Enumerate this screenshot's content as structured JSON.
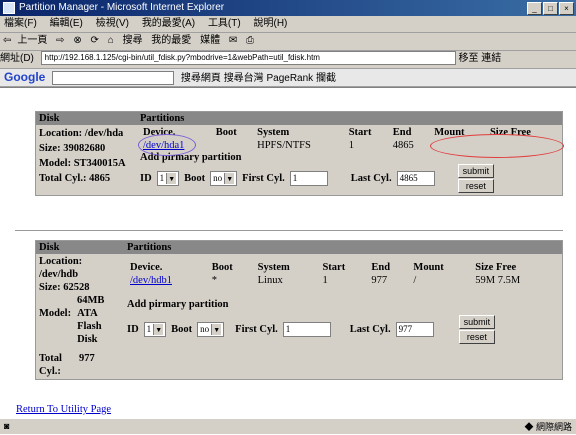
{
  "window": {
    "title": "Partition Manager - Microsoft Internet Explorer"
  },
  "menu": [
    "檔案(F)",
    "編輯(E)",
    "檢視(V)",
    "我的最愛(A)",
    "工具(T)",
    "說明(H)"
  ],
  "toolbar": {
    "back": "上一頁",
    "search": "搜尋",
    "favorites": "我的最愛",
    "media": "媒體"
  },
  "address": {
    "label": "網址(D)",
    "url": "http://192.168.1.125/cgi-bin/util_fdisk.py?mbodrive=1&webPath=util_fdisk.htm",
    "go": "移至",
    "links": "連結"
  },
  "google": {
    "brand": "Google",
    "search_web": "搜尋網頁",
    "search_site": "搜尋台灣",
    "pagerank": "PageRank",
    "blocked": "攔截"
  },
  "disk1": {
    "header_disk": "Disk",
    "header_partitions": "Partitions",
    "location_label": "Location:",
    "location": "/dev/hda",
    "size_label": "Size:",
    "size": "39082680",
    "model_label": "Model:",
    "model": "ST340015A",
    "total_label": "Total Cyl.:",
    "total": "4865",
    "cols": [
      "Device.",
      "Boot",
      "System",
      "Start",
      "End",
      "Mount",
      "Size Free"
    ],
    "row": {
      "device": "/dev/hda1",
      "boot": "",
      "system": "HPFS/NTFS",
      "start": "1",
      "end": "4865",
      "mount": "",
      "size_free": ""
    },
    "add_title": "Add pirmary partition",
    "id_label": "ID",
    "id_value": "1",
    "boot_label": "Boot",
    "boot_value": "no",
    "first_label": "First Cyl.",
    "first_value": "1",
    "last_label": "Last Cyl.",
    "last_value": "4865",
    "submit": "submit",
    "reset": "reset"
  },
  "disk2": {
    "header_disk": "Disk",
    "header_partitions": "Partitions",
    "location_label": "Location:",
    "location": "/dev/hdb",
    "size_label": "Size:",
    "size": "62528",
    "size2": "64MB",
    "model_label": "Model:",
    "model": "ATA Flash Disk",
    "total_label": "Total Cyl.:",
    "total": "977",
    "cols": [
      "Device.",
      "Boot",
      "System",
      "Start",
      "End",
      "Mount",
      "Size Free"
    ],
    "row": {
      "device": "/dev/hdb1",
      "boot": "*",
      "system": "Linux",
      "start": "1",
      "end": "977",
      "mount": "/",
      "size_free": "59M 7.5M"
    },
    "add_title": "Add pirmary partition",
    "id_label": "ID",
    "id_value": "1",
    "boot_label": "Boot",
    "boot_value": "no",
    "first_label": "First Cyl.",
    "first_value": "1",
    "last_label": "Last Cyl.",
    "last_value": "977",
    "submit": "submit",
    "reset": "reset"
  },
  "footer": {
    "return_link": "Return To Utility Page"
  },
  "status": {
    "zone": "網際網路"
  }
}
